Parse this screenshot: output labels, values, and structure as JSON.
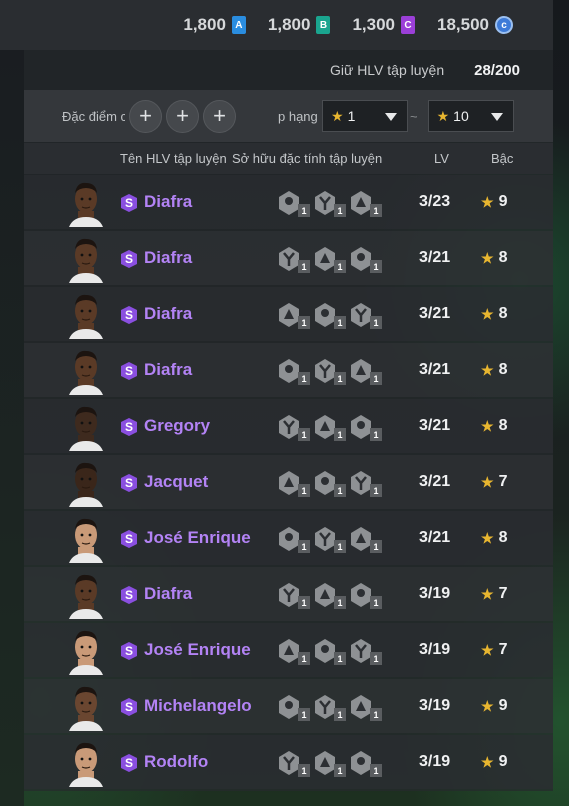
{
  "currencies": [
    {
      "value": "1,800",
      "icon": "A",
      "color": "#2a8de0"
    },
    {
      "value": "1,800",
      "icon": "B",
      "color": "#1aa58f"
    },
    {
      "value": "1,300",
      "icon": "C",
      "color": "#9b3fd8"
    },
    {
      "value": "18,500",
      "icon": "coin-icon",
      "color": "#3e7bd8"
    }
  ],
  "storage": {
    "label": "Giữ HLV tập luyện",
    "value": "28/200"
  },
  "filters": {
    "trait_label": "Đặc điểm c",
    "plus": "+",
    "rank_label": "p hạng",
    "rank_min": "1",
    "rank_max": "10",
    "separator": "~"
  },
  "columns": {
    "name": "Tên HLV tập luyện",
    "traits": "Sở hữu đặc tính tập luyện",
    "lv": "LV",
    "rank": "Bậc"
  },
  "rows": [
    {
      "name": "Diafra",
      "lv": "3/23",
      "rank": "9",
      "trait_levels": [
        "1",
        "1",
        "1"
      ]
    },
    {
      "name": "Diafra",
      "lv": "3/21",
      "rank": "8",
      "trait_levels": [
        "1",
        "1",
        "1"
      ]
    },
    {
      "name": "Diafra",
      "lv": "3/21",
      "rank": "8",
      "trait_levels": [
        "1",
        "1",
        "1"
      ]
    },
    {
      "name": "Diafra",
      "lv": "3/21",
      "rank": "8",
      "trait_levels": [
        "1",
        "1",
        "1"
      ]
    },
    {
      "name": "Gregory",
      "lv": "3/21",
      "rank": "8",
      "trait_levels": [
        "1",
        "1",
        "1"
      ]
    },
    {
      "name": "Jacquet",
      "lv": "3/21",
      "rank": "7",
      "trait_levels": [
        "1",
        "1",
        "1"
      ]
    },
    {
      "name": "José Enrique",
      "lv": "3/21",
      "rank": "8",
      "trait_levels": [
        "1",
        "1",
        "1"
      ]
    },
    {
      "name": "Diafra",
      "lv": "3/19",
      "rank": "7",
      "trait_levels": [
        "1",
        "1",
        "1"
      ]
    },
    {
      "name": "José Enrique",
      "lv": "3/19",
      "rank": "7",
      "trait_levels": [
        "1",
        "1",
        "1"
      ]
    },
    {
      "name": "Michelangelo",
      "lv": "3/19",
      "rank": "9",
      "trait_levels": [
        "1",
        "1",
        "1"
      ]
    },
    {
      "name": "Rodolfo",
      "lv": "3/19",
      "rank": "9",
      "trait_levels": [
        "1",
        "1",
        "1"
      ]
    }
  ],
  "badge_letter": "S",
  "colors": {
    "accent_name": "#b383f5",
    "star": "#e8b630",
    "badge": "#8a4fe0"
  }
}
